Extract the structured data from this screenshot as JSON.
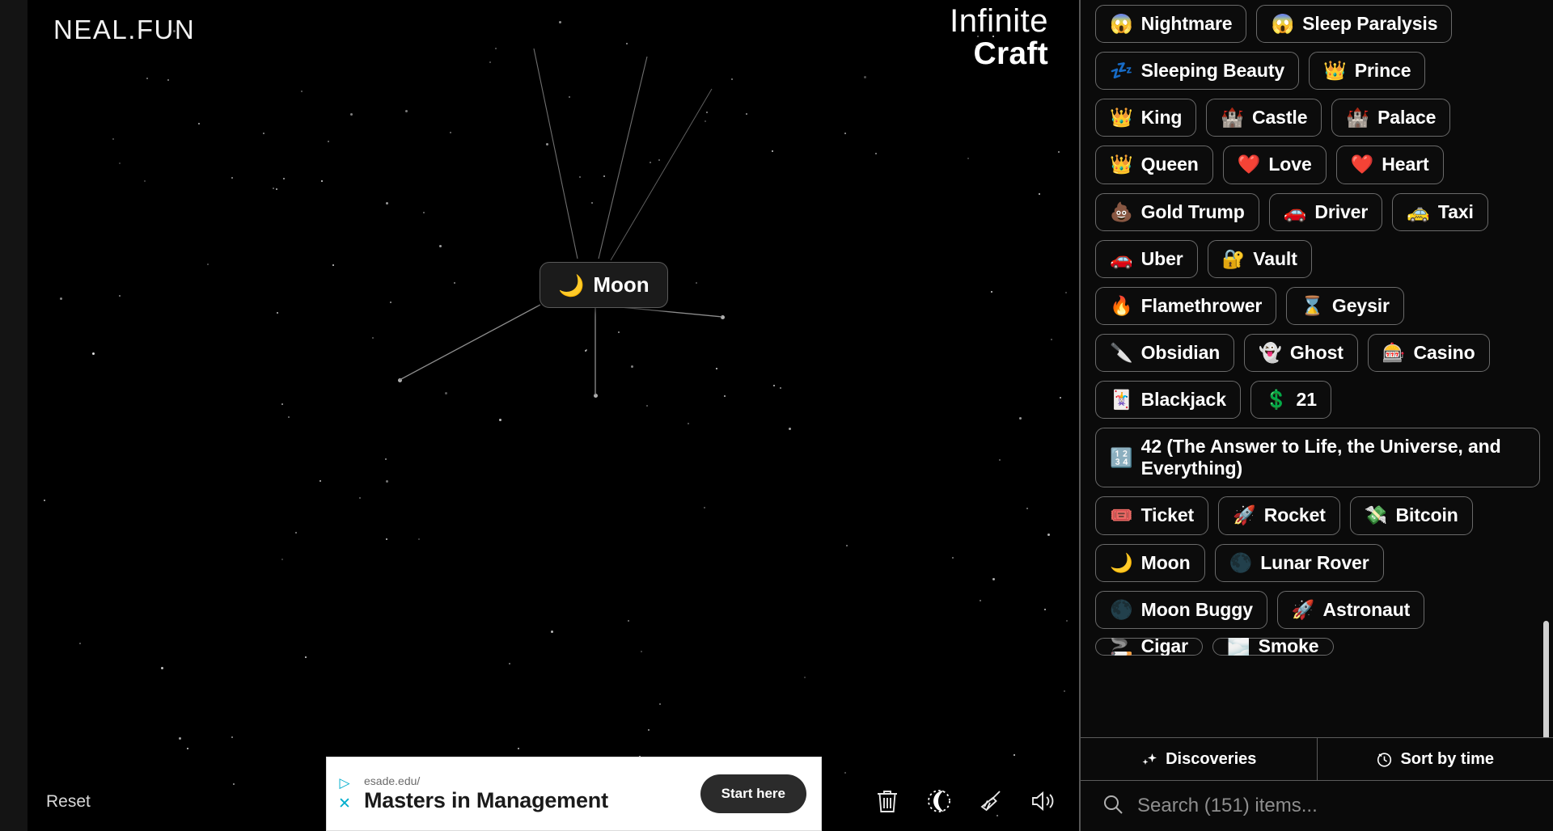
{
  "brand": {
    "logo": "NEAL.FUN"
  },
  "game": {
    "title_line1": "Infinite",
    "title_line2": "Craft"
  },
  "canvas": {
    "node": {
      "emoji": "🌙",
      "label": "Moon"
    },
    "reset_label": "Reset",
    "tools": [
      {
        "name": "trash-icon",
        "label": "Clear board"
      },
      {
        "name": "dark-mode-icon",
        "label": "Dark mode"
      },
      {
        "name": "broom-icon",
        "label": "Tidy up"
      },
      {
        "name": "sound-icon",
        "label": "Sound"
      }
    ]
  },
  "ad": {
    "url": "esade.edu/",
    "headline": "Masters in Management",
    "cta": "Start here",
    "adchoices_glyph": "▷",
    "close_glyph": "✕"
  },
  "sidebar": {
    "rows": [
      [
        {
          "emoji": "😱",
          "label": "Nightmare"
        },
        {
          "emoji": "😱",
          "label": "Sleep Paralysis"
        }
      ],
      [
        {
          "emoji": "💤",
          "label": "Sleeping Beauty"
        },
        {
          "emoji": "👑",
          "label": "Prince"
        }
      ],
      [
        {
          "emoji": "👑",
          "label": "King"
        },
        {
          "emoji": "🏰",
          "label": "Castle"
        },
        {
          "emoji": "🏰",
          "label": "Palace"
        }
      ],
      [
        {
          "emoji": "👑",
          "label": "Queen"
        },
        {
          "emoji": "❤️",
          "label": "Love"
        },
        {
          "emoji": "❤️",
          "label": "Heart"
        }
      ],
      [
        {
          "emoji": "💩",
          "label": "Gold Trump"
        },
        {
          "emoji": "🚗",
          "label": "Driver"
        },
        {
          "emoji": "🚕",
          "label": "Taxi"
        }
      ],
      [
        {
          "emoji": "🚗",
          "label": "Uber"
        },
        {
          "emoji": "🔐",
          "label": "Vault"
        }
      ],
      [
        {
          "emoji": "🔥",
          "label": "Flamethrower"
        },
        {
          "emoji": "⌛",
          "label": "Geysir"
        }
      ],
      [
        {
          "emoji": "🔪",
          "label": "Obsidian"
        },
        {
          "emoji": "👻",
          "label": "Ghost"
        },
        {
          "emoji": "🎰",
          "label": "Casino"
        }
      ],
      [
        {
          "emoji": "🃏",
          "label": "Blackjack"
        },
        {
          "emoji": "💲",
          "label": "21"
        }
      ],
      [
        {
          "emoji": "🔢",
          "label": "42 (The Answer to Life, the Universe, and Everything)",
          "wide": true
        }
      ],
      [
        {
          "emoji": "🎟️",
          "label": "Ticket"
        },
        {
          "emoji": "🚀",
          "label": "Rocket"
        },
        {
          "emoji": "💸",
          "label": "Bitcoin"
        }
      ],
      [
        {
          "emoji": "🌙",
          "label": "Moon"
        },
        {
          "emoji": "🌑",
          "label": "Lunar Rover"
        }
      ],
      [
        {
          "emoji": "🌑",
          "label": "Moon Buggy"
        },
        {
          "emoji": "🚀",
          "label": "Astronaut"
        }
      ]
    ],
    "clipped_row": [
      {
        "emoji": "🚬",
        "label": "Cigar"
      },
      {
        "emoji": "🌫️",
        "label": "Smoke"
      }
    ],
    "tabs": [
      {
        "icon": "sparkles-icon",
        "label": "Discoveries"
      },
      {
        "icon": "clock-icon",
        "label": "Sort by time"
      }
    ],
    "search": {
      "placeholder": "Search (151) items...",
      "value": ""
    }
  }
}
